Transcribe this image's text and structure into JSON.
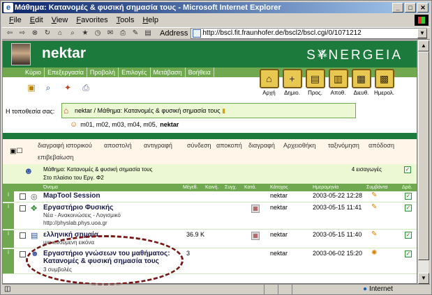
{
  "window": {
    "title": "Μάθημα: Κατανομές & φυσική σημασία τους - Microsoft Internet Explorer",
    "min_label": "_",
    "max_label": "□",
    "close_label": "✕"
  },
  "menu": [
    "File",
    "Edit",
    "View",
    "Favorites",
    "Tools",
    "Help"
  ],
  "toolbar": {
    "address_label": "Address",
    "url": "http://bscl.fit.fraunhofer.de/bscl2/bscl.cgi/0/1071212"
  },
  "banner": {
    "username": "nektar",
    "brand": "SYNERGEIA"
  },
  "site_menu": [
    "Κύριο",
    "Επεξεργασία",
    "Προβολή",
    "Επιλογές",
    "Μετάβαση",
    "Βοήθεια"
  ],
  "big_buttons": [
    {
      "icon": "home-icon",
      "label": "Αρχή"
    },
    {
      "icon": "create-icon",
      "label": "Δημιο."
    },
    {
      "icon": "add-icon",
      "label": "Προς."
    },
    {
      "icon": "save-icon",
      "label": "Αποθ."
    },
    {
      "icon": "address-icon",
      "label": "Διευθ."
    },
    {
      "icon": "calendar-icon",
      "label": "Ημερολ."
    }
  ],
  "location": {
    "label": "Η τοποθεσία σας:",
    "path": "nektar / Μάθημα: Κατανομές & φυσική σημασία τους",
    "members": "m01, m02, m03, m04, m05,",
    "members_bold": "nektar"
  },
  "commands": [
    "διαγραφή ιστορικού",
    "αποστολή",
    "αντιγραφή",
    "σύνδεση",
    "αποκοπή",
    "διαγραφή",
    "Αρχειοθήκη",
    "ταξινόμηση",
    "απόδοση",
    "επιβεβαίωση"
  ],
  "folder": {
    "title": "Μάθημα: Κατανομές & φυσική σημασία τους",
    "subtitle": "Στο πλαίσιο του Εργ. Φ2",
    "count": "4 εισαγωγές"
  },
  "columns": {
    "name": "Όνομα",
    "size": "Μέγεθ.",
    "share": "Κοινή.",
    "sync": "Συγχ.",
    "status": "Κατά.",
    "owner": "Κάτοχος",
    "date": "Ημερομηνία",
    "events": "Συμβάντα",
    "action": "Δρά."
  },
  "rows": [
    {
      "name": "MapTool Session",
      "sub1": "",
      "sub2": "",
      "size": "",
      "owner": "nektar",
      "date": "2003-05-22 12:28"
    },
    {
      "name": "Εργαστήριο Φυσικής",
      "sub1": "Νέα - Ανακοινώσεις - Λογισμικό",
      "sub2": "http://physlab.phys.uoa.gr",
      "size": "",
      "owner": "nektar",
      "date": "2003-05-15 11:41"
    },
    {
      "name": "ελληνική σημαία",
      "sub1": "μια κινούμενη εικόνα",
      "sub2": "",
      "size": "36.9 K",
      "owner": "nektar",
      "date": "2003-05-15 11:40"
    },
    {
      "name": "Εργαστήριο γνώσεων του μαθήματος: Κατανομές & φυσική σημασία τους",
      "name1": "Εργαστήριο γνώσεων του μαθήματος:",
      "name2": "Κατανομές & φυσική σημασία τους",
      "sub1": "3 συμβολές",
      "sub2": "",
      "size": "3",
      "owner": "nektar",
      "date": "2003-06-02 15:20"
    }
  ],
  "status": {
    "zone": "Internet"
  }
}
